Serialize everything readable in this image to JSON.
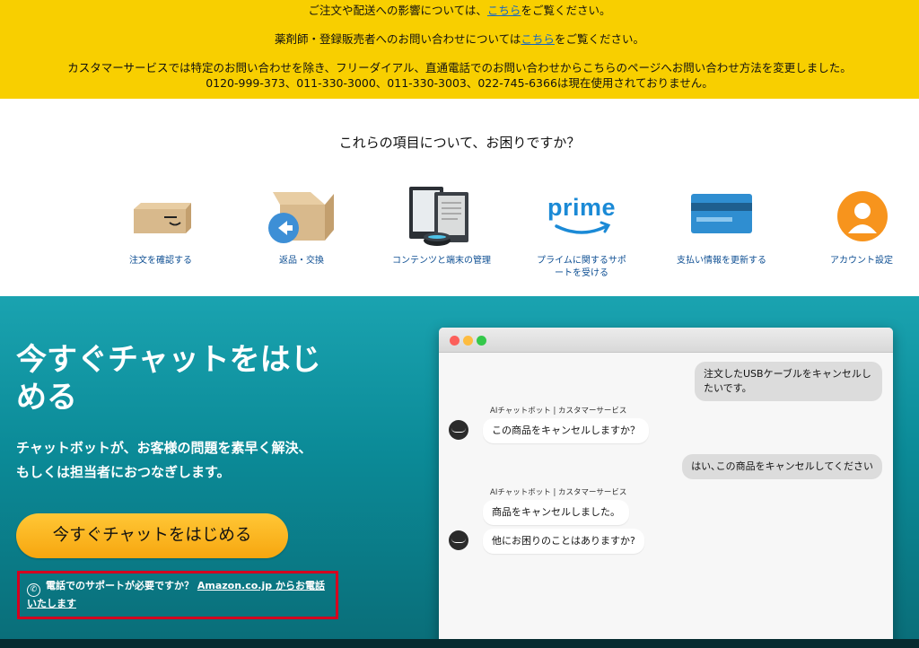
{
  "banner": {
    "line1_pre": "ご注文や配送への影響については、",
    "line1_link": "こちら",
    "line1_post": "をご覧ください。",
    "line2_pre": "薬剤師・登録販売者へのお問い合わせについては",
    "line2_link": "こちら",
    "line2_post": "をご覧ください。",
    "line3": "カスタマーサービスでは特定のお問い合わせを除き、フリーダイアル、直通電話でのお問い合わせからこちらのページへお問い合わせ方法を変更しました。",
    "line4": "0120-999-373、011-330-3000、011-330-3003、022-745-6366は現在使用されておりません。"
  },
  "help": {
    "title": "これらの項目について、お困りですか？",
    "topics": [
      {
        "label": "注文を確認する",
        "icon": "package-box-icon"
      },
      {
        "label": "返品・交換",
        "icon": "return-box-icon"
      },
      {
        "label": "コンテンツと端末の管理",
        "icon": "devices-icon"
      },
      {
        "label": "プライムに関するサポートを受ける",
        "icon": "prime-logo-icon"
      },
      {
        "label": "支払い情報を更新する",
        "icon": "credit-card-icon"
      },
      {
        "label": "アカウント設定",
        "icon": "account-avatar-icon"
      }
    ],
    "prime_word": "prime"
  },
  "chat": {
    "title": "今すぐチャットをはじめる",
    "subtitle": "チャットボットが、お客様の問題を素早く解決、もしくは担当者におつなぎします。",
    "cta_label": "今すぐチャットをはじめる",
    "phone_text": "電話でのサポートが必要ですか？",
    "phone_link": "Amazon.co.jp からお電話いたします"
  },
  "mock_window": {
    "messages": [
      {
        "from": "user",
        "text": "注文したUSBケーブルをキャンセルしたいです。"
      },
      {
        "from": "bot",
        "meta": "AIチャットボット | カスタマーサービス",
        "text": "この商品をキャンセルしますか？"
      },
      {
        "from": "user",
        "text": "はい､この商品をキャンセルしてください"
      },
      {
        "from": "bot",
        "meta": "AIチャットボット | カスタマーサービス",
        "text": "商品をキャンセルしました。"
      },
      {
        "from": "bot",
        "text": "他にお困りのことはありますか?"
      }
    ]
  },
  "colors": {
    "banner": "#f8cf00",
    "link": "#1466c6",
    "teal": "#0b8a97",
    "cta": "#f7a60f",
    "highlight_border": "#d4001f"
  }
}
